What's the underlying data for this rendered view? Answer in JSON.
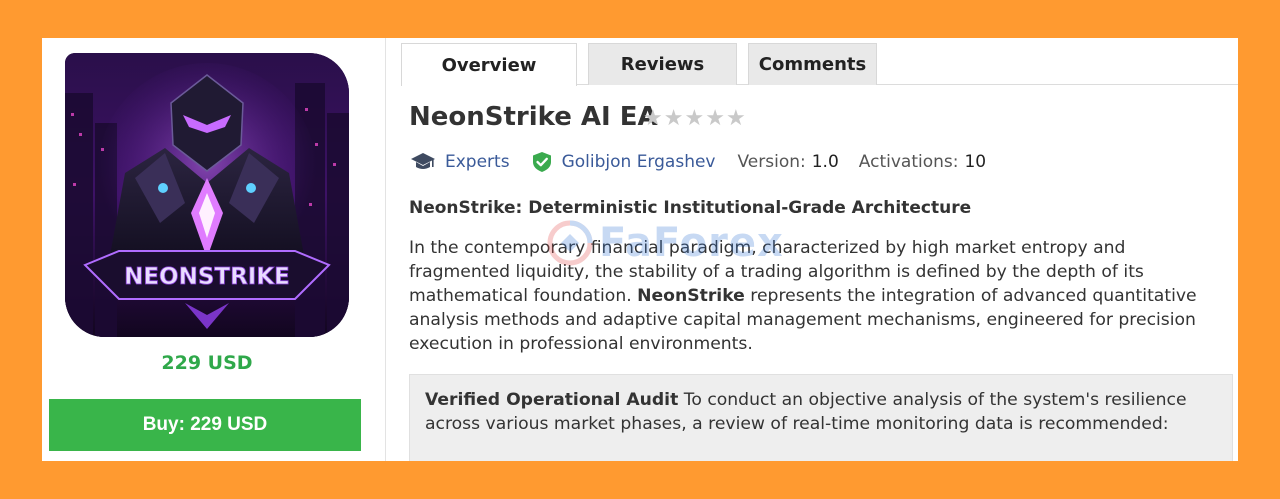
{
  "product": {
    "price": "229 USD",
    "buy_label": "Buy: 229 USD",
    "image_logo_text": "NEONSTRIKE",
    "title": "NeonStrike AI EA",
    "rating_stars": 0
  },
  "tabs": [
    {
      "label": "Overview",
      "active": true
    },
    {
      "label": "Reviews",
      "active": false
    },
    {
      "label": "Comments",
      "active": false
    }
  ],
  "meta": {
    "category": "Experts",
    "category_icon": "graduation-cap-icon",
    "author": "Golibjon Ergashev",
    "author_icon": "verified-shield-icon",
    "version_label": "Version:",
    "version_value": "1.0",
    "activations_label": "Activations:",
    "activations_value": "10"
  },
  "description": {
    "subtitle": "NeonStrike: Deterministic Institutional-Grade Architecture",
    "paragraph_part1": "In the contemporary financial paradigm, characterized by high market entropy and fragmented liquidity, the stability of a trading algorithm is defined by the depth of its mathematical foundation. ",
    "paragraph_bold": "NeonStrike",
    "paragraph_part2": " represents the integration of advanced quantitative analysis methods and adaptive capital management mechanisms, engineered for precision execution in professional environments."
  },
  "audit": {
    "heading": "Verified Operational Audit",
    "text": " To conduct an objective analysis of the system's resilience across various market phases, a review of real-time monitoring data is recommended:"
  },
  "watermark": {
    "text": "FaForex"
  },
  "colors": {
    "background": "#ff9a30",
    "price_green": "#2fa84a",
    "buy_button": "#39b54a",
    "link_blue": "#3a5a99"
  }
}
